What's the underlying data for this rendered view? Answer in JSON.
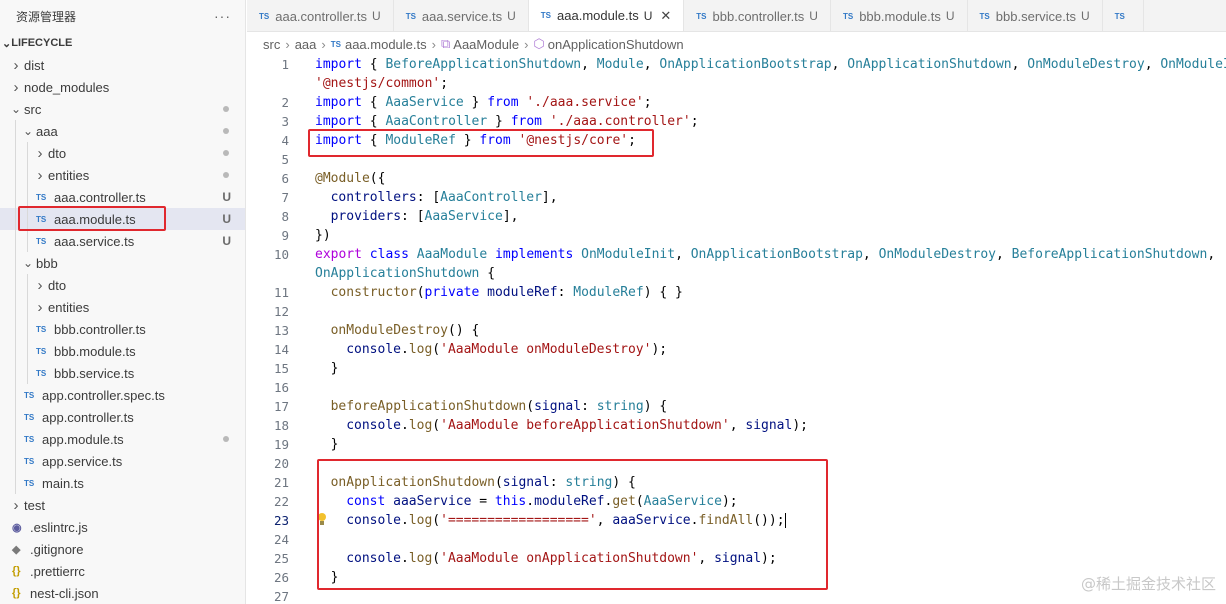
{
  "sidebar": {
    "title": "资源管理器",
    "more": "···",
    "project": "LIFECYCLE",
    "items": [
      {
        "label": "dist",
        "kind": "folder",
        "depth": 0,
        "open": false,
        "badge": ""
      },
      {
        "label": "node_modules",
        "kind": "folder",
        "depth": 0,
        "open": false,
        "badge": ""
      },
      {
        "label": "src",
        "kind": "folder",
        "depth": 0,
        "open": true,
        "badge": "dot"
      },
      {
        "label": "aaa",
        "kind": "folder",
        "depth": 1,
        "open": true,
        "badge": "dot"
      },
      {
        "label": "dto",
        "kind": "folder",
        "depth": 2,
        "open": false,
        "badge": "dot"
      },
      {
        "label": "entities",
        "kind": "folder",
        "depth": 2,
        "open": false,
        "badge": "dot"
      },
      {
        "label": "aaa.controller.ts",
        "kind": "ts",
        "depth": 2,
        "badge": "U"
      },
      {
        "label": "aaa.module.ts",
        "kind": "ts",
        "depth": 2,
        "badge": "U",
        "active": true
      },
      {
        "label": "aaa.service.ts",
        "kind": "ts",
        "depth": 2,
        "badge": "U"
      },
      {
        "label": "bbb",
        "kind": "folder",
        "depth": 1,
        "open": true,
        "badge": ""
      },
      {
        "label": "dto",
        "kind": "folder",
        "depth": 2,
        "open": false,
        "badge": ""
      },
      {
        "label": "entities",
        "kind": "folder",
        "depth": 2,
        "open": false,
        "badge": ""
      },
      {
        "label": "bbb.controller.ts",
        "kind": "ts",
        "depth": 2,
        "badge": ""
      },
      {
        "label": "bbb.module.ts",
        "kind": "ts",
        "depth": 2,
        "badge": ""
      },
      {
        "label": "bbb.service.ts",
        "kind": "ts",
        "depth": 2,
        "badge": ""
      },
      {
        "label": "app.controller.spec.ts",
        "kind": "ts",
        "depth": 1,
        "badge": ""
      },
      {
        "label": "app.controller.ts",
        "kind": "ts",
        "depth": 1,
        "badge": ""
      },
      {
        "label": "app.module.ts",
        "kind": "ts",
        "depth": 1,
        "badge": "dot"
      },
      {
        "label": "app.service.ts",
        "kind": "ts",
        "depth": 1,
        "badge": ""
      },
      {
        "label": "main.ts",
        "kind": "ts",
        "depth": 1,
        "badge": ""
      },
      {
        "label": "test",
        "kind": "folder",
        "depth": 0,
        "open": false,
        "badge": ""
      },
      {
        "label": ".eslintrc.js",
        "kind": "eslint",
        "depth": 0,
        "badge": ""
      },
      {
        "label": ".gitignore",
        "kind": "git",
        "depth": 0,
        "badge": ""
      },
      {
        "label": ".prettierrc",
        "kind": "json",
        "depth": 0,
        "badge": ""
      },
      {
        "label": "nest-cli.json",
        "kind": "json",
        "depth": 0,
        "badge": ""
      }
    ]
  },
  "tabs": [
    {
      "label": "aaa.controller.ts",
      "badge": "U",
      "active": false
    },
    {
      "label": "aaa.service.ts",
      "badge": "U",
      "active": false
    },
    {
      "label": "aaa.module.ts",
      "badge": "U",
      "active": true
    },
    {
      "label": "bbb.controller.ts",
      "badge": "U",
      "active": false
    },
    {
      "label": "bbb.module.ts",
      "badge": "U",
      "active": false
    },
    {
      "label": "bbb.service.ts",
      "badge": "U",
      "active": false
    },
    {
      "label": "",
      "badge": "",
      "active": false
    }
  ],
  "tab_icon": "TS",
  "breadcrumb": [
    "src",
    "aaa",
    "aaa.module.ts",
    "AaaModule",
    "onApplicationShutdown"
  ],
  "editor": {
    "current_line": "23",
    "lines": [
      {
        "n": "1",
        "indent": 0,
        "tokens": [
          [
            "k",
            "import"
          ],
          [
            "",
            "{ "
          ],
          [
            "t",
            "BeforeApplicationShutdown"
          ],
          [
            "",
            ", "
          ],
          [
            "t",
            "Module"
          ],
          [
            "",
            ", "
          ],
          [
            "t",
            "OnApplicationBootstrap"
          ],
          [
            "",
            ", "
          ],
          [
            "t",
            "OnApplicationShutdown"
          ],
          [
            "",
            ", "
          ],
          [
            "t",
            "OnModuleDestroy"
          ],
          [
            "",
            ", "
          ],
          [
            "t",
            "OnModuleInit"
          ],
          [
            "",
            ", "
          ]
        ]
      },
      {
        "n": "",
        "indent": 0,
        "tokens": [
          [
            "s",
            "'@nestjs/common'"
          ],
          [
            "",
            ";"
          ]
        ]
      },
      {
        "n": "2",
        "indent": 0,
        "tokens": [
          [
            "k",
            "import"
          ],
          [
            "",
            "{ "
          ],
          [
            "t",
            "AaaService"
          ],
          [
            "",
            " } "
          ],
          [
            "k",
            "from"
          ],
          [
            "",
            " "
          ],
          [
            "s",
            "'./aaa.service'"
          ],
          [
            "",
            ";"
          ]
        ]
      },
      {
        "n": "3",
        "indent": 0,
        "tokens": [
          [
            "k",
            "import"
          ],
          [
            "",
            "{ "
          ],
          [
            "t",
            "AaaController"
          ],
          [
            "",
            " } "
          ],
          [
            "k",
            "from"
          ],
          [
            "",
            " "
          ],
          [
            "s",
            "'./aaa.controller'"
          ],
          [
            "",
            ";"
          ]
        ]
      },
      {
        "n": "4",
        "indent": 0,
        "tokens": [
          [
            "k",
            "import"
          ],
          [
            "",
            "{ "
          ],
          [
            "t",
            "ModuleRef"
          ],
          [
            "",
            " } "
          ],
          [
            "k",
            "from"
          ],
          [
            "",
            " "
          ],
          [
            "s",
            "'@nestjs/core'"
          ],
          [
            "",
            ";"
          ]
        ]
      },
      {
        "n": "5",
        "indent": 0,
        "tokens": []
      },
      {
        "n": "6",
        "indent": 0,
        "tokens": [
          [
            "f",
            "@Module"
          ],
          [
            "",
            "({"
          ]
        ]
      },
      {
        "n": "7",
        "indent": 1,
        "tokens": [
          [
            "v",
            "controllers"
          ],
          [
            "",
            ": ["
          ],
          [
            "t",
            "AaaController"
          ],
          [
            "",
            "],"
          ]
        ]
      },
      {
        "n": "8",
        "indent": 1,
        "tokens": [
          [
            "v",
            "providers"
          ],
          [
            "",
            ": ["
          ],
          [
            "t",
            "AaaService"
          ],
          [
            "",
            "],"
          ]
        ]
      },
      {
        "n": "9",
        "indent": 0,
        "tokens": [
          [
            "",
            "})"
          ]
        ]
      },
      {
        "n": "10",
        "indent": 0,
        "tokens": [
          [
            "c",
            "export"
          ],
          [
            "",
            " "
          ],
          [
            "k",
            "class"
          ],
          [
            "",
            " "
          ],
          [
            "t",
            "AaaModule"
          ],
          [
            "",
            " "
          ],
          [
            "k",
            "implements"
          ],
          [
            "",
            " "
          ],
          [
            "t",
            "OnModuleInit"
          ],
          [
            "",
            ", "
          ],
          [
            "t",
            "OnApplicationBootstrap"
          ],
          [
            "",
            ", "
          ],
          [
            "t",
            "OnModuleDestroy"
          ],
          [
            "",
            ", "
          ],
          [
            "t",
            "BeforeApplicationShutdown"
          ],
          [
            "",
            ","
          ]
        ]
      },
      {
        "n": "",
        "indent": 0,
        "tokens": [
          [
            "t",
            "OnApplicationShutdown"
          ],
          [
            "",
            " {"
          ]
        ]
      },
      {
        "n": "11",
        "indent": 1,
        "tokens": [
          [
            "f",
            "constructor"
          ],
          [
            "",
            "("
          ],
          [
            "k",
            "private"
          ],
          [
            "",
            " "
          ],
          [
            "v",
            "moduleRef"
          ],
          [
            "",
            ": "
          ],
          [
            "t",
            "ModuleRef"
          ],
          [
            "",
            ") { }"
          ]
        ]
      },
      {
        "n": "12",
        "indent": 0,
        "tokens": []
      },
      {
        "n": "13",
        "indent": 1,
        "tokens": [
          [
            "f",
            "onModuleDestroy"
          ],
          [
            "",
            "() {"
          ]
        ]
      },
      {
        "n": "14",
        "indent": 2,
        "tokens": [
          [
            "v",
            "console"
          ],
          [
            "",
            "."
          ],
          [
            "f",
            "log"
          ],
          [
            "",
            "("
          ],
          [
            "s",
            "'AaaModule onModuleDestroy'"
          ],
          [
            "",
            ");"
          ]
        ]
      },
      {
        "n": "15",
        "indent": 1,
        "tokens": [
          [
            "",
            "}"
          ]
        ]
      },
      {
        "n": "16",
        "indent": 0,
        "tokens": []
      },
      {
        "n": "17",
        "indent": 1,
        "tokens": [
          [
            "f",
            "beforeApplicationShutdown"
          ],
          [
            "",
            "("
          ],
          [
            "v",
            "signal"
          ],
          [
            "",
            ": "
          ],
          [
            "t",
            "string"
          ],
          [
            "",
            ") {"
          ]
        ]
      },
      {
        "n": "18",
        "indent": 2,
        "tokens": [
          [
            "v",
            "console"
          ],
          [
            "",
            "."
          ],
          [
            "f",
            "log"
          ],
          [
            "",
            "("
          ],
          [
            "s",
            "'AaaModule beforeApplicationShutdown'"
          ],
          [
            "",
            ", "
          ],
          [
            "v",
            "signal"
          ],
          [
            "",
            ");"
          ]
        ]
      },
      {
        "n": "19",
        "indent": 1,
        "tokens": [
          [
            "",
            "}"
          ]
        ]
      },
      {
        "n": "20",
        "indent": 0,
        "tokens": []
      },
      {
        "n": "21",
        "indent": 1,
        "tokens": [
          [
            "f",
            "onApplicationShutdown"
          ],
          [
            "",
            "("
          ],
          [
            "v",
            "signal"
          ],
          [
            "",
            ": "
          ],
          [
            "t",
            "string"
          ],
          [
            "",
            ") {"
          ]
        ]
      },
      {
        "n": "22",
        "indent": 2,
        "tokens": [
          [
            "k",
            "const"
          ],
          [
            "",
            " "
          ],
          [
            "v",
            "aaaService"
          ],
          [
            "",
            " = "
          ],
          [
            "k",
            "this"
          ],
          [
            "",
            "."
          ],
          [
            "v",
            "moduleRef"
          ],
          [
            "",
            "."
          ],
          [
            "f",
            "get"
          ],
          [
            "",
            "("
          ],
          [
            "t",
            "AaaService"
          ],
          [
            "",
            ");"
          ]
        ]
      },
      {
        "n": "23",
        "indent": 2,
        "tokens": [
          [
            "v",
            "console"
          ],
          [
            "",
            "."
          ],
          [
            "f",
            "log"
          ],
          [
            "",
            "("
          ],
          [
            "s",
            "'=================='"
          ],
          [
            "",
            ", "
          ],
          [
            "v",
            "aaaService"
          ],
          [
            "",
            "."
          ],
          [
            "f",
            "findAll"
          ],
          [
            "",
            "());"
          ]
        ]
      },
      {
        "n": "24",
        "indent": 0,
        "tokens": []
      },
      {
        "n": "25",
        "indent": 2,
        "tokens": [
          [
            "v",
            "console"
          ],
          [
            "",
            "."
          ],
          [
            "f",
            "log"
          ],
          [
            "",
            "("
          ],
          [
            "s",
            "'AaaModule onApplicationShutdown'"
          ],
          [
            "",
            ", "
          ],
          [
            "v",
            "signal"
          ],
          [
            "",
            ");"
          ]
        ]
      },
      {
        "n": "26",
        "indent": 1,
        "tokens": [
          [
            "",
            "}"
          ]
        ]
      },
      {
        "n": "27",
        "indent": 0,
        "tokens": []
      }
    ]
  },
  "watermark": "@稀土掘金技术社区",
  "colors": {
    "highlight_box": "#e0282e",
    "ts_icon": "#3178c6",
    "active_row": "#e4e6f1"
  }
}
